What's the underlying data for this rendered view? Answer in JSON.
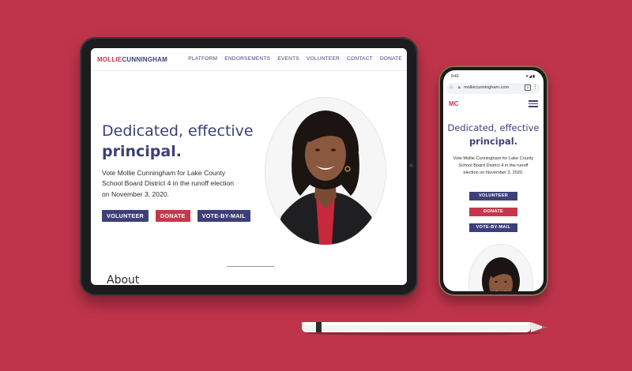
{
  "site": {
    "logo_first": "MOLLIE",
    "logo_last": "CUNNINGHAM",
    "logo_initials": "MC",
    "nav": [
      "PLATFORM",
      "ENDORSEMENTS",
      "EVENTS",
      "VOLUNTEER",
      "CONTACT",
      "DONATE"
    ],
    "headline_line1": "Dedicated, effective",
    "headline_line2": "principal.",
    "subtitle": "Vote Mollie Cunningham for Lake County School Board District 4 in the runoff election on November 3, 2020.",
    "buttons": [
      "VOLUNTEER",
      "DONATE",
      "VOTE-BY-MAIL"
    ],
    "about_heading": "About"
  },
  "phone": {
    "status_time": "9:41",
    "url": "molliecunningham.com"
  },
  "colors": {
    "background": "#c0344b",
    "brand_blue": "#3d3f79",
    "brand_red": "#c7374b"
  }
}
